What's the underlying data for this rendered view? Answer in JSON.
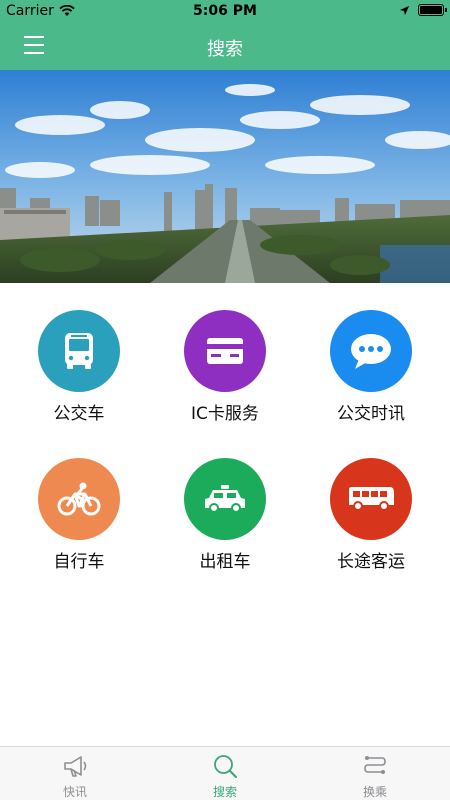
{
  "status_bar": {
    "carrier": "Carrier",
    "time": "5:06 PM"
  },
  "navbar": {
    "title": "搜索"
  },
  "colors": {
    "nav_green": "#4cb98a",
    "bus": "#2aa0bd",
    "ic": "#8e2fc2",
    "news": "#1a8cf0",
    "bike": "#ee8a4f",
    "taxi": "#1bab5b",
    "coach": "#d7361c",
    "tab_active": "#3aa57a"
  },
  "grid": {
    "items": [
      {
        "label": "公交车",
        "icon": "bus-icon"
      },
      {
        "label": "IC卡服务",
        "icon": "card-icon"
      },
      {
        "label": "公交时讯",
        "icon": "chat-bubble-icon"
      },
      {
        "label": "自行车",
        "icon": "bicycle-icon"
      },
      {
        "label": "出租车",
        "icon": "taxi-icon"
      },
      {
        "label": "长途客运",
        "icon": "coach-bus-icon"
      }
    ]
  },
  "tabbar": {
    "items": [
      {
        "label": "快讯",
        "icon": "megaphone-icon",
        "active": false
      },
      {
        "label": "搜索",
        "icon": "search-icon",
        "active": true
      },
      {
        "label": "换乘",
        "icon": "transfer-icon",
        "active": false
      }
    ]
  }
}
